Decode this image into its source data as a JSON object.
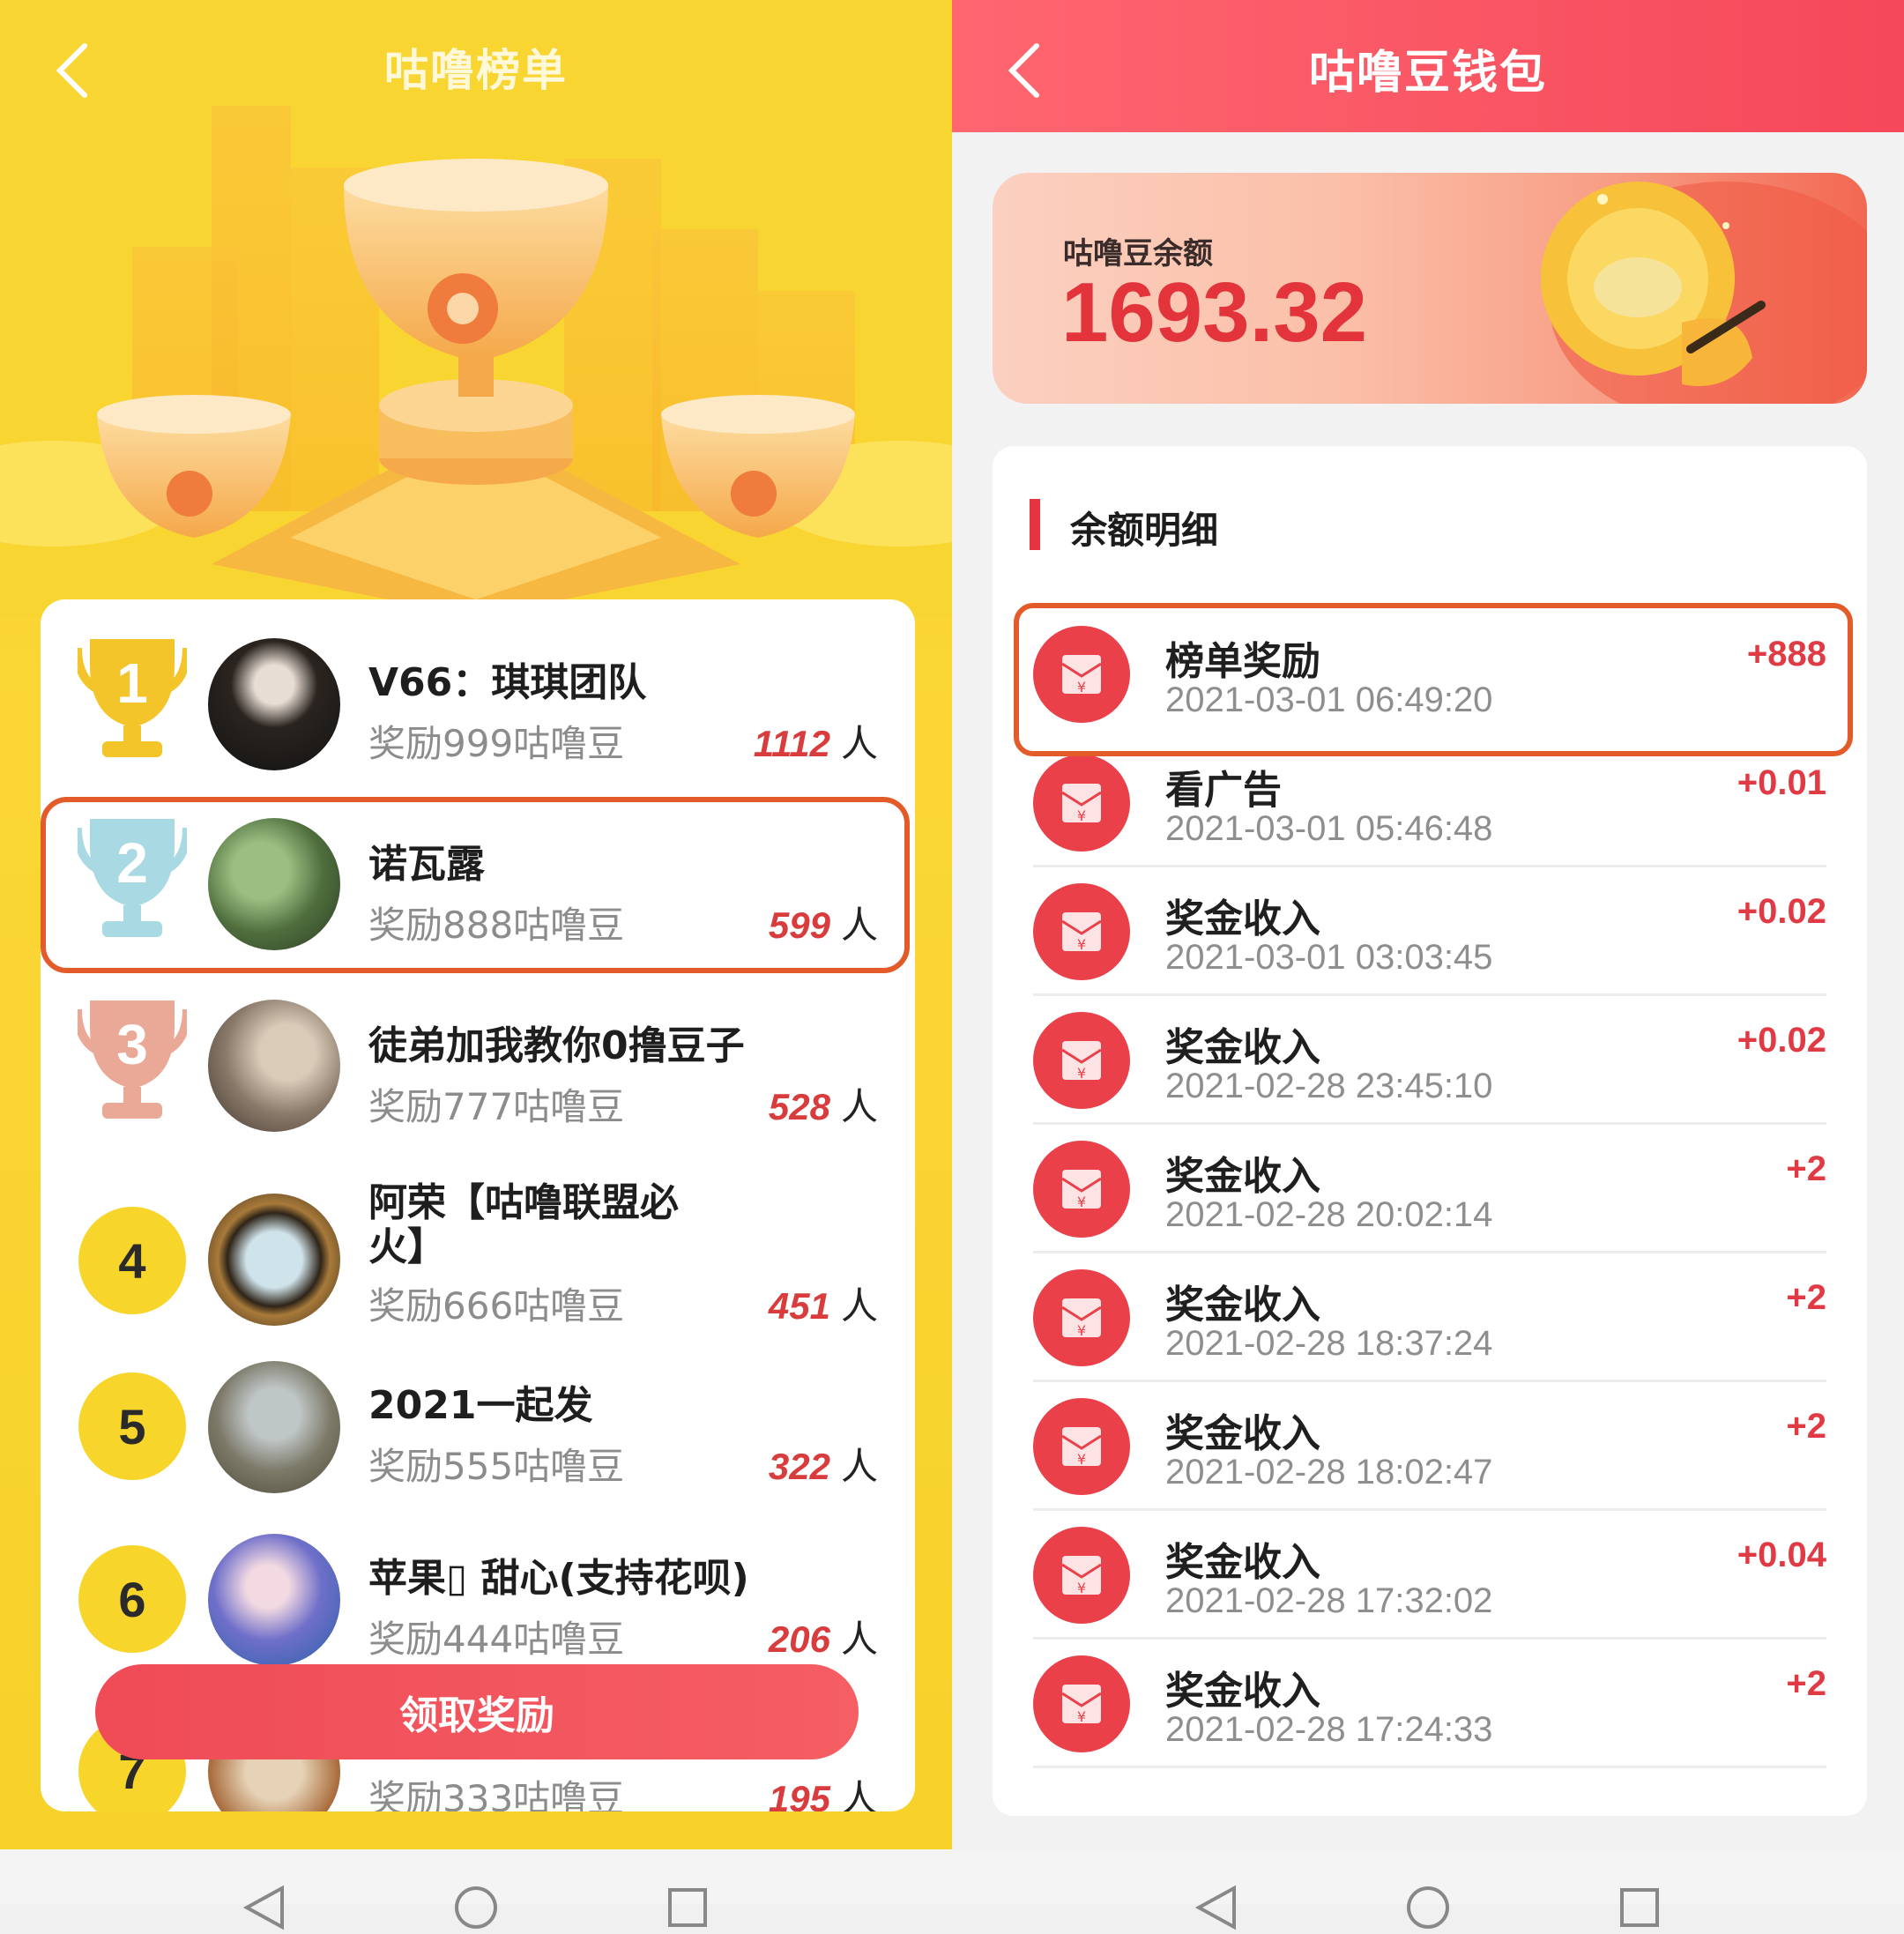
{
  "left_screen": {
    "title": "咕噜榜单",
    "ranking": [
      {
        "rank": "1",
        "name": "V66：琪琪团队",
        "reward": "奖励999咕噜豆",
        "count": "1112",
        "unit": "人",
        "badge": "gold-trophy"
      },
      {
        "rank": "2",
        "name": "诺瓦露",
        "reward": "奖励888咕噜豆",
        "count": "599",
        "unit": "人",
        "badge": "silver-trophy"
      },
      {
        "rank": "3",
        "name": "徒弟加我教你0撸豆子",
        "reward": "奖励777咕噜豆",
        "count": "528",
        "unit": "人",
        "badge": "bronze-trophy"
      },
      {
        "rank": "4",
        "name": "阿荣【咕噜联盟必火】",
        "reward": "奖励666咕噜豆",
        "count": "451",
        "unit": "人",
        "badge": "circle"
      },
      {
        "rank": "5",
        "name": "2021一起发",
        "reward": "奖励555咕噜豆",
        "count": "322",
        "unit": "人",
        "badge": "circle"
      },
      {
        "rank": "6",
        "name": "苹果▯ 甜心(支持花呗)",
        "reward": "奖励444咕噜豆",
        "count": "206",
        "unit": "人",
        "badge": "circle"
      },
      {
        "rank": "7",
        "name": "",
        "reward": "奖励333咕噜豆",
        "count": "195",
        "unit": "人",
        "badge": "circle"
      }
    ],
    "claim_button": "领取奖励"
  },
  "right_screen": {
    "title": "咕噜豆钱包",
    "balance_label": "咕噜豆余额",
    "balance_value": "1693.32",
    "section_title": "余额明细",
    "transactions": [
      {
        "title": "榜单奖励",
        "time": "2021-03-01 06:49:20",
        "amount": "+888"
      },
      {
        "title": "看广告",
        "time": "2021-03-01 05:46:48",
        "amount": "+0.01"
      },
      {
        "title": "奖金收入",
        "time": "2021-03-01 03:03:45",
        "amount": "+0.02"
      },
      {
        "title": "奖金收入",
        "time": "2021-02-28 23:45:10",
        "amount": "+0.02"
      },
      {
        "title": "奖金收入",
        "time": "2021-02-28 20:02:14",
        "amount": "+2"
      },
      {
        "title": "奖金收入",
        "time": "2021-02-28 18:37:24",
        "amount": "+2"
      },
      {
        "title": "奖金收入",
        "time": "2021-02-28 18:02:47",
        "amount": "+2"
      },
      {
        "title": "奖金收入",
        "time": "2021-02-28 17:32:02",
        "amount": "+0.04"
      },
      {
        "title": "奖金收入",
        "time": "2021-02-28 17:24:33",
        "amount": "+2"
      }
    ]
  },
  "colors": {
    "left_bg": "#f8d32d",
    "accent_red": "#e5343f",
    "highlight_border": "#e45b2a"
  }
}
